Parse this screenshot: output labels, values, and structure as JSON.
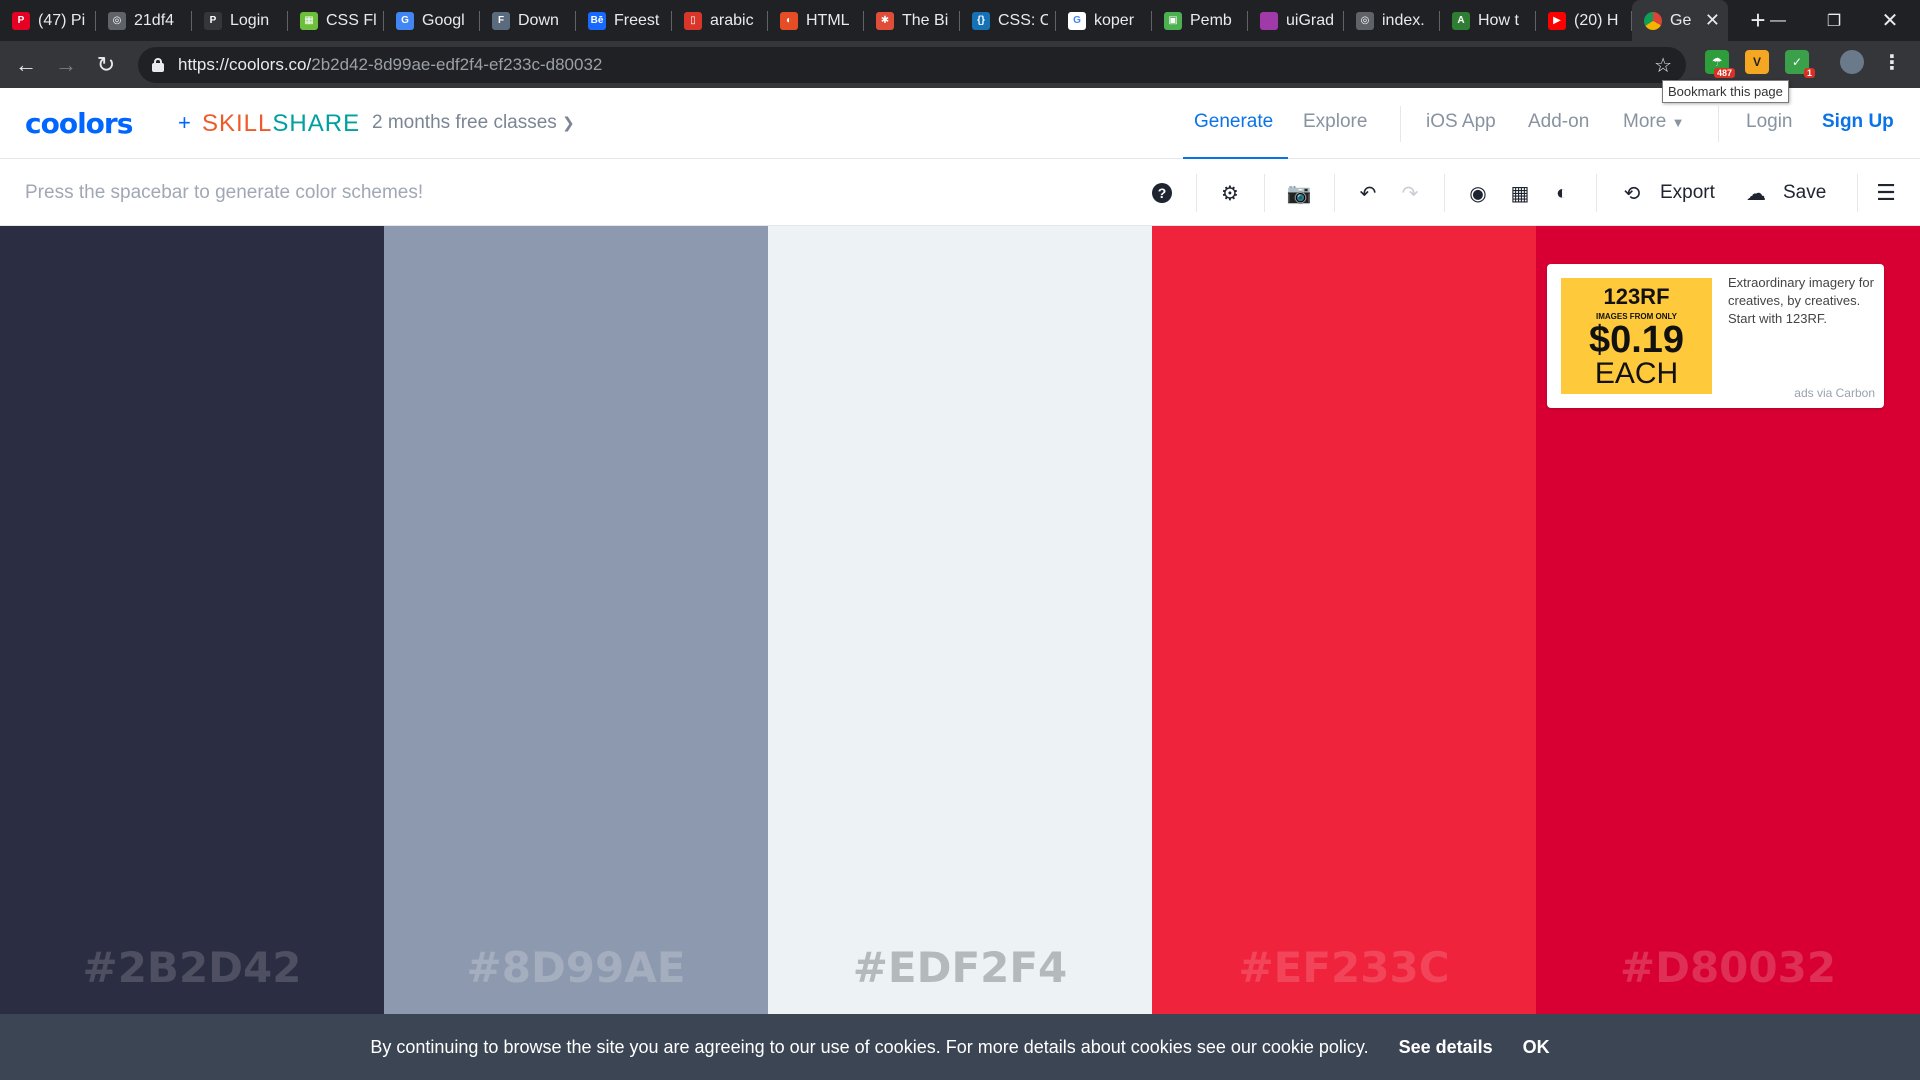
{
  "browser": {
    "tabs": [
      {
        "title": "(47) Pi",
        "icon": "pinterest-icon",
        "color": "#e60023",
        "glyph": "P"
      },
      {
        "title": "21df4",
        "icon": "globe-icon",
        "color": "#5f6368",
        "glyph": "◎"
      },
      {
        "title": "Login",
        "icon": "p-icon",
        "color": "#35363a",
        "glyph": "P"
      },
      {
        "title": "CSS Fl",
        "icon": "css-icon",
        "color": "#6dbf3b",
        "glyph": "▦"
      },
      {
        "title": "Googl",
        "icon": "google-translate-icon",
        "color": "#4285f4",
        "glyph": "G"
      },
      {
        "title": "Down",
        "icon": "f-icon",
        "color": "#5a6b7d",
        "glyph": "F"
      },
      {
        "title": "Freest",
        "icon": "behance-icon",
        "color": "#1769ff",
        "glyph": "Bē"
      },
      {
        "title": "arabic",
        "icon": "pdf-icon",
        "color": "#d8362b",
        "glyph": "▯"
      },
      {
        "title": "HTML",
        "icon": "html-icon",
        "color": "#e44d26",
        "glyph": "◐"
      },
      {
        "title": "The Bi",
        "icon": "badge-icon",
        "color": "#e04e39",
        "glyph": "✱"
      },
      {
        "title": "CSS: C",
        "icon": "css-c-icon",
        "color": "#1572b6",
        "glyph": "{}"
      },
      {
        "title": "koper",
        "icon": "google-icon",
        "color": "#ffffff",
        "glyph": "G"
      },
      {
        "title": "Pemb",
        "icon": "image-icon",
        "color": "#4caf50",
        "glyph": "▣"
      },
      {
        "title": "uiGrad",
        "icon": "gradient-icon",
        "color": "#a03aa8",
        "glyph": ""
      },
      {
        "title": "index.",
        "icon": "globe-icon",
        "color": "#5f6368",
        "glyph": "◎"
      },
      {
        "title": "How t",
        "icon": "android-icon",
        "color": "#2e7d32",
        "glyph": "A"
      },
      {
        "title": "(20) H",
        "icon": "youtube-icon",
        "color": "#ff0000",
        "glyph": "▶"
      }
    ],
    "active_tab": {
      "title": "Ge",
      "icon": "chrome-icon"
    },
    "url_host": "https://coolors.co/",
    "url_path": "2b2d42-8d99ae-edf2f4-ef233c-d80032",
    "tooltip": "Bookmark this page",
    "ext_badge_1": "487",
    "ext_badge_2": "1"
  },
  "site": {
    "logo": "coolors",
    "plus": "+",
    "partner_a": "SKILL",
    "partner_b": "SHARE",
    "promo": "2 months free classes",
    "nav": {
      "generate": "Generate",
      "explore": "Explore",
      "ios": "iOS App",
      "addon": "Add-on",
      "more": "More",
      "login": "Login",
      "signup": "Sign Up"
    },
    "hint": "Press the spacebar to generate color schemes!",
    "export": "Export",
    "save": "Save"
  },
  "palette": [
    {
      "hex": "#2B2D42",
      "bg": "#2b2d42",
      "label_color": "#4e5061"
    },
    {
      "hex": "#8D99AE",
      "bg": "#8d99ae",
      "label_color": "#a5aebf"
    },
    {
      "hex": "#EDF2F4",
      "bg": "#edf2f4",
      "label_color": "#b4b9bb"
    },
    {
      "hex": "#EF233C",
      "bg": "#ef233c",
      "label_color": "#f2455a"
    },
    {
      "hex": "#D80032",
      "bg": "#d80032",
      "label_color": "#df2f57"
    }
  ],
  "ad": {
    "brand": "123RF",
    "small": "IMAGES FROM ONLY",
    "price": "$0.19",
    "each": "EACH",
    "text": "Extraordinary imagery for creatives, by creatives. Start with 123RF.",
    "via": "ads via Carbon"
  },
  "cookie": {
    "text": "By continuing to browse the site you are agreeing to our use of cookies. For more details about cookies see our cookie policy.",
    "details": "See details",
    "ok": "OK"
  }
}
